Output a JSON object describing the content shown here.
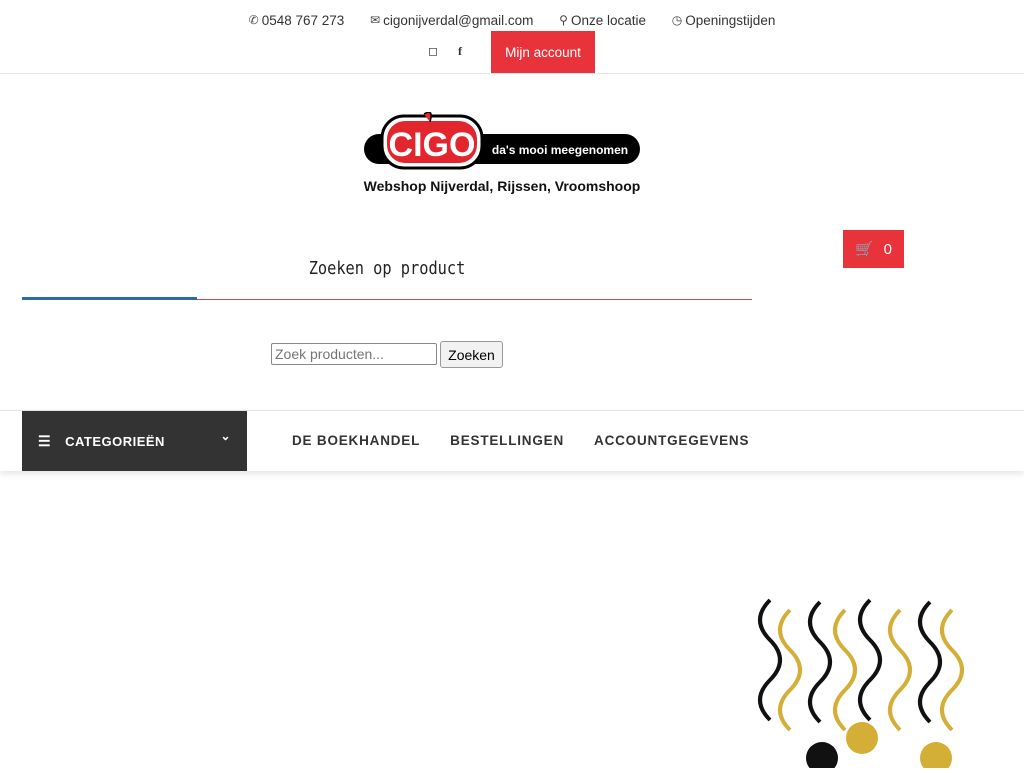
{
  "topbar": {
    "phone": "0548 767 273",
    "email": "cigonijverdal@gmail.com",
    "location": "Onze locatie",
    "hours": "Openingstijden",
    "account_label": "Mijn account"
  },
  "icons": {
    "phone": "phone-icon",
    "email": "envelope-icon",
    "location": "map-marker-icon",
    "hours": "clock-icon",
    "instagram": "instagram-icon",
    "facebook": "facebook-icon",
    "cart": "cart-icon",
    "menu": "hamburger-icon",
    "chevron": "chevron-down-icon"
  },
  "logo": {
    "brand": "CIGO",
    "tagline": "da's mooi meegenomen",
    "subtitle": "Webshop Nijverdal, Rijssen, Vroomshoop"
  },
  "cart": {
    "count": "0"
  },
  "search": {
    "title": "Zoeken op product",
    "placeholder": "Zoek producten...",
    "button": "Zoeken"
  },
  "nav": {
    "categories_label": "CATEGORIEËN",
    "items": [
      "DE BOEKHANDEL",
      "BESTELLINGEN",
      "ACCOUNTGEGEVENS"
    ]
  },
  "colors": {
    "accent": "#e8333b",
    "dark": "#333333",
    "blue": "#2f6aa8"
  }
}
